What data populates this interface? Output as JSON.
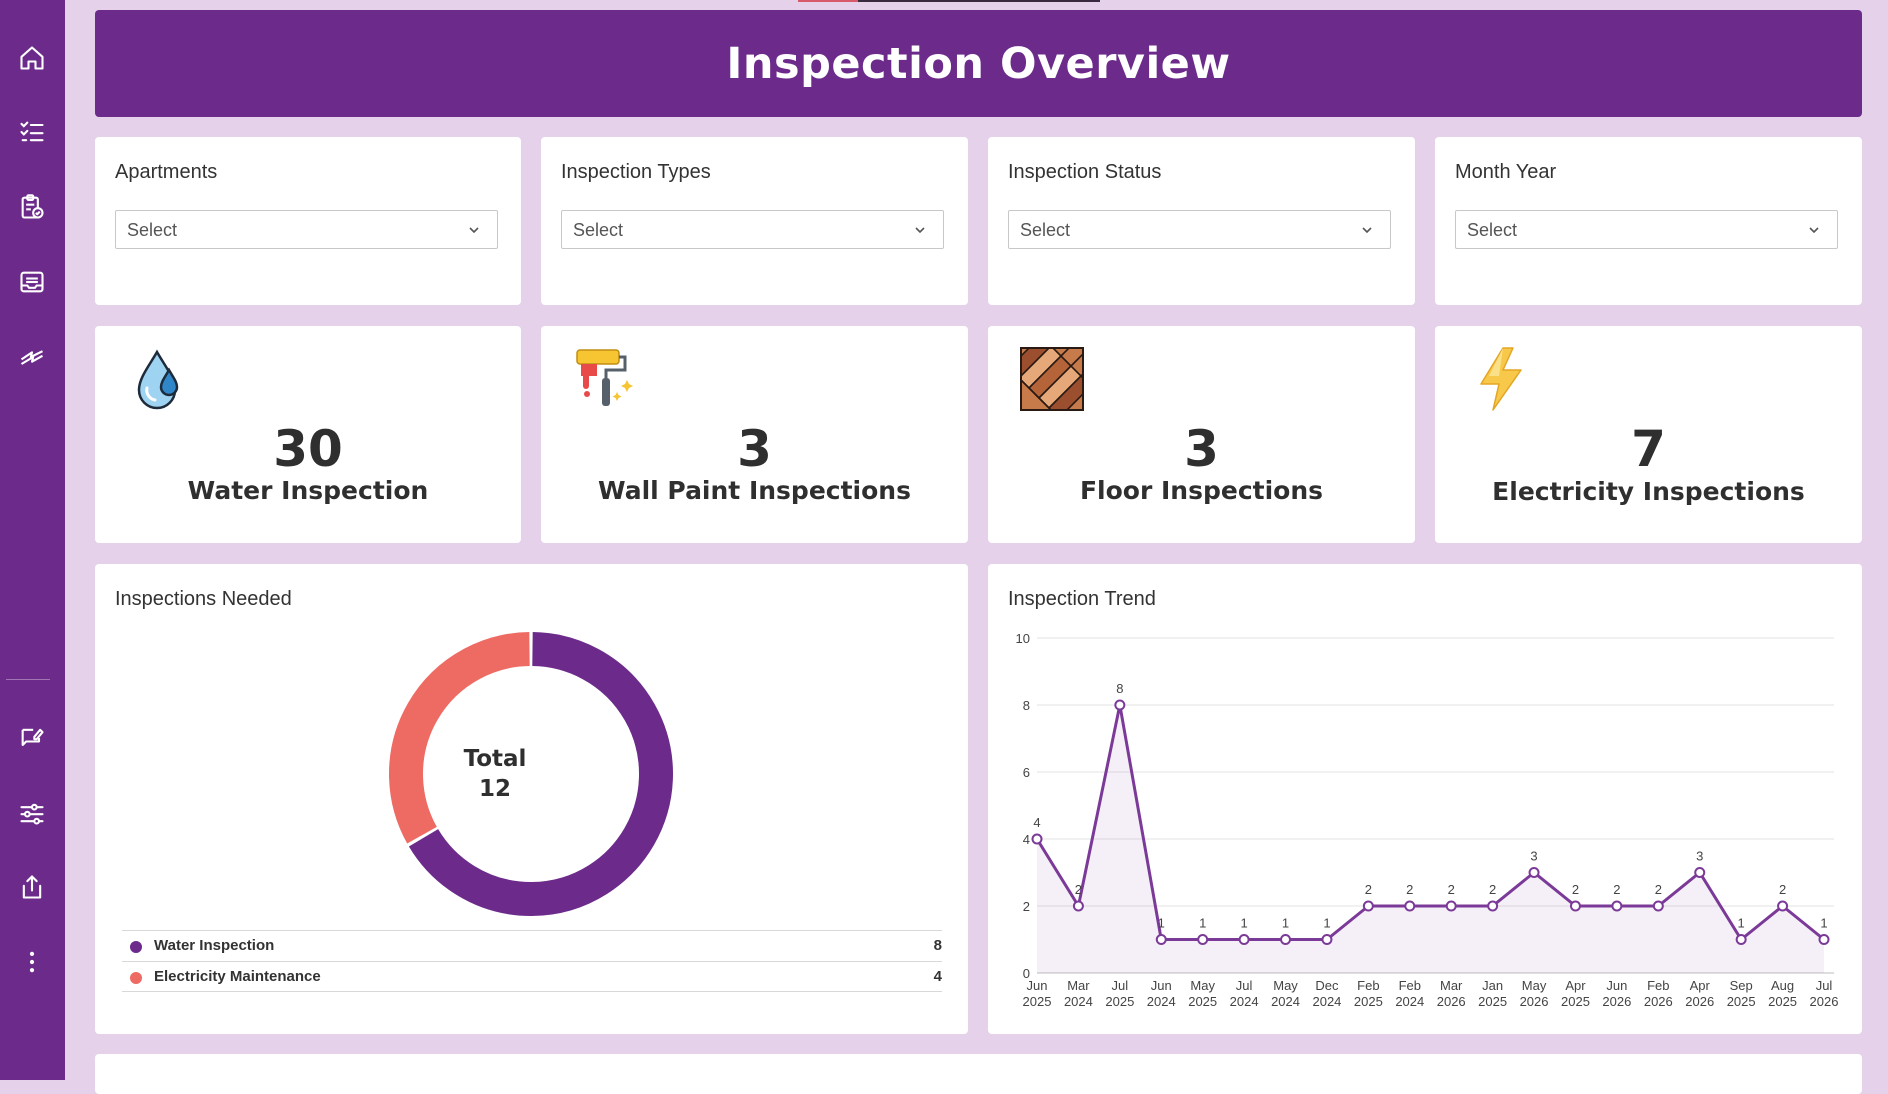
{
  "header": {
    "title": "Inspection Overview"
  },
  "sidebar": {
    "items": [
      {
        "name": "home-icon"
      },
      {
        "name": "checklist-icon"
      },
      {
        "name": "clipboard-check-icon"
      },
      {
        "name": "inbox-icon"
      },
      {
        "name": "lightning-icon"
      },
      {
        "name": "edit-message-icon"
      },
      {
        "name": "sliders-icon"
      },
      {
        "name": "share-icon"
      },
      {
        "name": "more-vertical-icon"
      }
    ]
  },
  "filters": [
    {
      "label": "Apartments",
      "value": "Select"
    },
    {
      "label": "Inspection Types",
      "value": "Select"
    },
    {
      "label": "Inspection Status",
      "value": "Select"
    },
    {
      "label": "Month Year",
      "value": "Select"
    }
  ],
  "kpis": [
    {
      "value": "30",
      "label": "Water Inspection",
      "icon": "water-drop-icon"
    },
    {
      "value": "3",
      "label": "Wall Paint Inspections",
      "icon": "paint-roller-icon"
    },
    {
      "value": "3",
      "label": "Floor Inspections",
      "icon": "parquet-floor-icon"
    },
    {
      "value": "7",
      "label": "Electricity Inspections",
      "icon": "lightning-bolt-icon"
    }
  ],
  "inspections_needed": {
    "title": "Inspections Needed",
    "center_label": "Total",
    "center_value": "12",
    "legend": [
      {
        "name": "Water Inspection",
        "value": "8",
        "color": "#6c2b8b"
      },
      {
        "name": "Electricity Maintenance",
        "value": "4",
        "color": "#ee6b64"
      }
    ]
  },
  "trend": {
    "title": "Inspection Trend"
  },
  "chart_data": [
    {
      "type": "pie",
      "title": "Inspections Needed",
      "categories": [
        "Water Inspection",
        "Electricity Maintenance"
      ],
      "values": [
        8,
        4
      ],
      "colors": [
        "#6c2b8b",
        "#ee6b64"
      ],
      "donut": true,
      "center_text": "Total 12"
    },
    {
      "type": "area",
      "title": "Inspection Trend",
      "categories": [
        "Jun 2025",
        "Mar 2024",
        "Jul 2025",
        "Jun 2024",
        "May 2025",
        "Jul 2024",
        "May 2024",
        "Dec 2024",
        "Feb 2025",
        "Feb 2024",
        "Mar 2026",
        "Jan 2025",
        "May 2026",
        "Apr 2025",
        "Jun 2026",
        "Feb 2026",
        "Apr 2026",
        "Sep 2025",
        "Aug 2025",
        "Jul 2026"
      ],
      "values": [
        4,
        2,
        8,
        1,
        1,
        1,
        1,
        1,
        2,
        2,
        2,
        2,
        3,
        2,
        2,
        2,
        3,
        1,
        2,
        1
      ],
      "ylim": [
        0,
        10
      ],
      "yticks": [
        0,
        2,
        4,
        6,
        8,
        10
      ],
      "grid": true,
      "color": "#7b3a98"
    }
  ]
}
